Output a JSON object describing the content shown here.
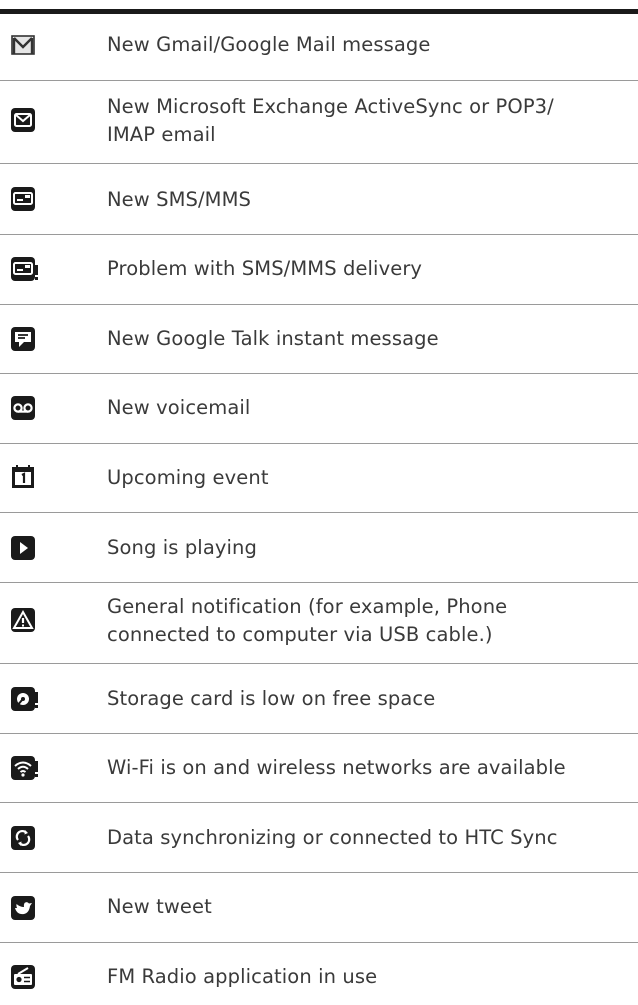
{
  "rows": [
    {
      "icon": "gmail-icon",
      "text": [
        "New Gmail/Google Mail message"
      ]
    },
    {
      "icon": "email-icon",
      "text": [
        "New Microsoft Exchange ActiveSync or POP3/",
        "IMAP email"
      ]
    },
    {
      "icon": "sms-icon",
      "text": [
        "New SMS/MMS"
      ]
    },
    {
      "icon": "sms-problem-icon",
      "text": [
        "Problem with SMS/MMS delivery"
      ]
    },
    {
      "icon": "google-talk-icon",
      "text": [
        "New Google Talk instant message"
      ]
    },
    {
      "icon": "voicemail-icon",
      "text": [
        "New voicemail"
      ]
    },
    {
      "icon": "calendar-icon",
      "text": [
        "Upcoming event"
      ]
    },
    {
      "icon": "play-icon",
      "text": [
        "Song is playing"
      ]
    },
    {
      "icon": "warning-icon",
      "text": [
        "General notification (for example, Phone",
        "connected to computer via USB cable.)"
      ]
    },
    {
      "icon": "storage-low-icon",
      "text": [
        "Storage card is low on free space"
      ]
    },
    {
      "icon": "wifi-icon",
      "text": [
        "Wi-Fi is on and wireless networks are available"
      ]
    },
    {
      "icon": "sync-icon",
      "text": [
        "Data synchronizing or connected to HTC Sync"
      ]
    },
    {
      "icon": "tweet-icon",
      "text": [
        "New tweet"
      ]
    },
    {
      "icon": "fm-radio-icon",
      "text": [
        "FM Radio application in use"
      ]
    }
  ]
}
